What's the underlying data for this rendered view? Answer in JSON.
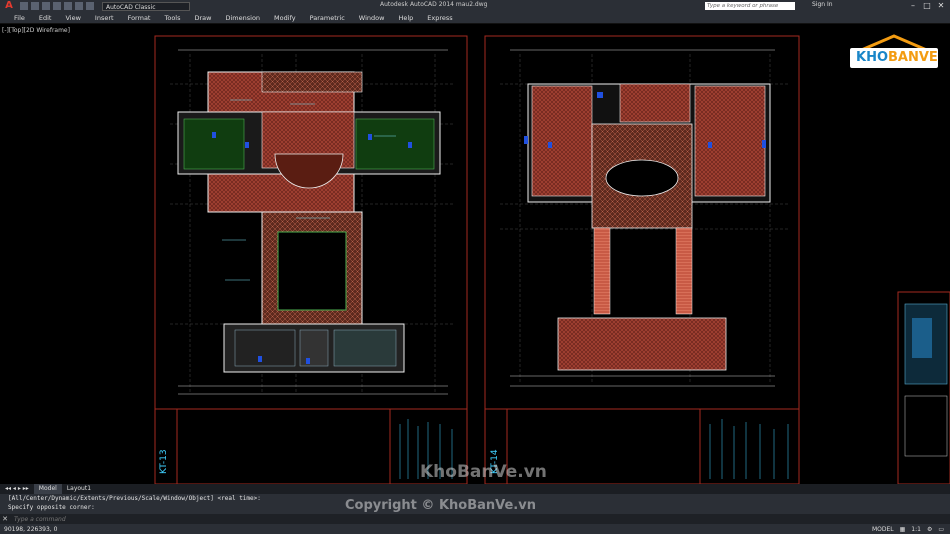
{
  "titlebar": {
    "app_logo": "A",
    "workspace": "AutoCAD Classic",
    "window_title": "Autodesk AutoCAD 2014    mau2.dwg",
    "search_placeholder": "Type a keyword or phrase",
    "signin": "Sign In"
  },
  "menu": [
    "File",
    "Edit",
    "View",
    "Insert",
    "Format",
    "Tools",
    "Draw",
    "Dimension",
    "Modify",
    "Parametric",
    "Window",
    "Help",
    "Express"
  ],
  "viewport": {
    "label": "[-][Top][2D Wireframe]"
  },
  "logo": {
    "brand_a": "KHO",
    "brand_b": "BANVE"
  },
  "sheets": {
    "left_title": "KT-13",
    "right_title": "KT-14"
  },
  "tabs": [
    "Model",
    "Layout1"
  ],
  "command": {
    "history": [
      "[All/Center/Dynamic/Extents/Previous/Scale/Window/Object] <real time>:",
      "Specify opposite corner:"
    ],
    "placeholder": "Type a command"
  },
  "status": {
    "coords": "90198, 226393, 0",
    "model": "MODEL",
    "scale": "1:1"
  },
  "watermarks": {
    "big": "KhoBanVe.vn",
    "copyright": "Copyright © KhoBanVe.vn"
  }
}
